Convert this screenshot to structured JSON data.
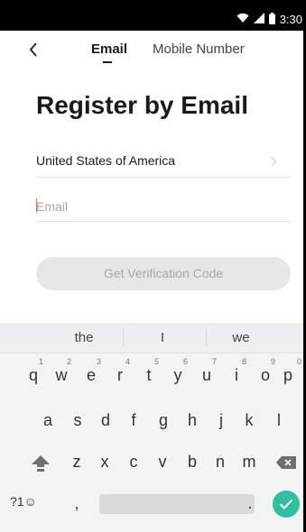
{
  "status_bar": {
    "time": "3:30",
    "icons": [
      "wifi-icon",
      "signal-icon",
      "battery-icon"
    ]
  },
  "nav": {
    "back_icon": "chevron-left-icon",
    "tabs": [
      {
        "label": "Email",
        "active": true
      },
      {
        "label": "Mobile Number",
        "active": false
      }
    ]
  },
  "page": {
    "title": "Register by Email",
    "country": {
      "label": "United States of America",
      "icon": "chevron-right-icon"
    },
    "email": {
      "placeholder": "Email",
      "value": ""
    },
    "submit_label": "Get Verification Code"
  },
  "keyboard": {
    "suggestions": [
      "the",
      "I",
      "we"
    ],
    "row1": [
      {
        "key": "q",
        "hint": "1"
      },
      {
        "key": "w",
        "hint": "2"
      },
      {
        "key": "e",
        "hint": "3"
      },
      {
        "key": "r",
        "hint": "4"
      },
      {
        "key": "t",
        "hint": "5"
      },
      {
        "key": "y",
        "hint": "6"
      },
      {
        "key": "u",
        "hint": "7"
      },
      {
        "key": "i",
        "hint": "8"
      },
      {
        "key": "o",
        "hint": "9"
      },
      {
        "key": "p",
        "hint": "0"
      }
    ],
    "row2": [
      "a",
      "s",
      "d",
      "f",
      "g",
      "h",
      "j",
      "k",
      "l"
    ],
    "row3": [
      "z",
      "x",
      "c",
      "v",
      "b",
      "n",
      "m"
    ],
    "symbols_label": "?1☺",
    "comma": ",",
    "period": ".",
    "icons": {
      "shift": "shift-icon",
      "backspace": "backspace-icon",
      "enter": "checkmark-icon"
    },
    "colors": {
      "enter": "#32bfa0"
    }
  }
}
